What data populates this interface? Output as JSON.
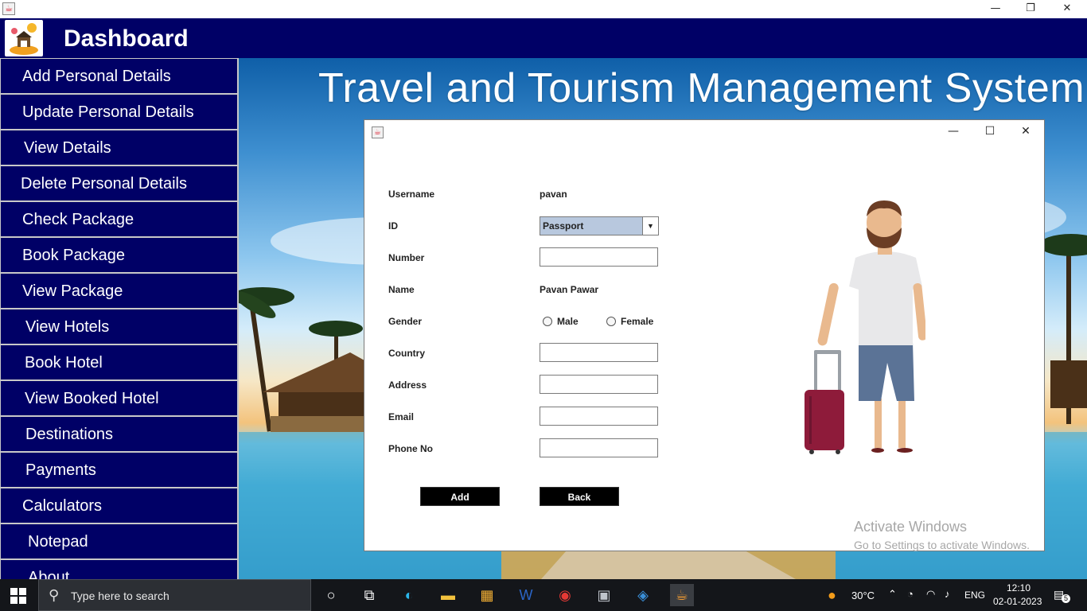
{
  "window": {
    "controls": {
      "minimize": "—",
      "restore": "❐",
      "close": "✕"
    }
  },
  "header": {
    "title": "Dashboard"
  },
  "sidebar": {
    "items": [
      {
        "label": "Add Personal Details"
      },
      {
        "label": "Update Personal Details"
      },
      {
        "label": "View Details"
      },
      {
        "label": "Delete Personal Details"
      },
      {
        "label": "Check Package"
      },
      {
        "label": "Book Package"
      },
      {
        "label": "View Package"
      },
      {
        "label": "View Hotels"
      },
      {
        "label": "Book Hotel"
      },
      {
        "label": "View Booked Hotel"
      },
      {
        "label": "Destinations"
      },
      {
        "label": "Payments"
      },
      {
        "label": "Calculators"
      },
      {
        "label": "Notepad"
      },
      {
        "label": "About"
      }
    ]
  },
  "banner": {
    "title": "Travel and Tourism Management System"
  },
  "dialog": {
    "controls": {
      "minimize": "—",
      "maximize": "☐",
      "close": "✕"
    },
    "labels": {
      "username": "Username",
      "id": "ID",
      "number": "Number",
      "name": "Name",
      "gender": "Gender",
      "country": "Country",
      "address": "Address",
      "email": "Email",
      "phone": "Phone No"
    },
    "values": {
      "username": "pavan",
      "id_selected": "Passport",
      "name": "Pavan Pawar"
    },
    "gender_options": {
      "male": "Male",
      "female": "Female"
    },
    "buttons": {
      "add": "Add",
      "back": "Back"
    }
  },
  "watermark": {
    "line1": "Activate Windows",
    "line2": "Go to Settings to activate Windows."
  },
  "taskbar": {
    "search_placeholder": "Type here to search",
    "weather": "30°C",
    "language": "ENG",
    "time": "12:10",
    "date": "02-01-2023",
    "notification_count": "5",
    "icons": [
      "windows-start-icon",
      "cortana-icon",
      "task-view-icon",
      "edge-icon",
      "file-explorer-icon",
      "store-icon",
      "word-icon",
      "chrome-icon",
      "photos-icon",
      "virtualbox-icon",
      "java-icon"
    ]
  },
  "colors": {
    "navy": "#000066",
    "button_black": "#000000",
    "select_bg": "#b8c8de"
  }
}
